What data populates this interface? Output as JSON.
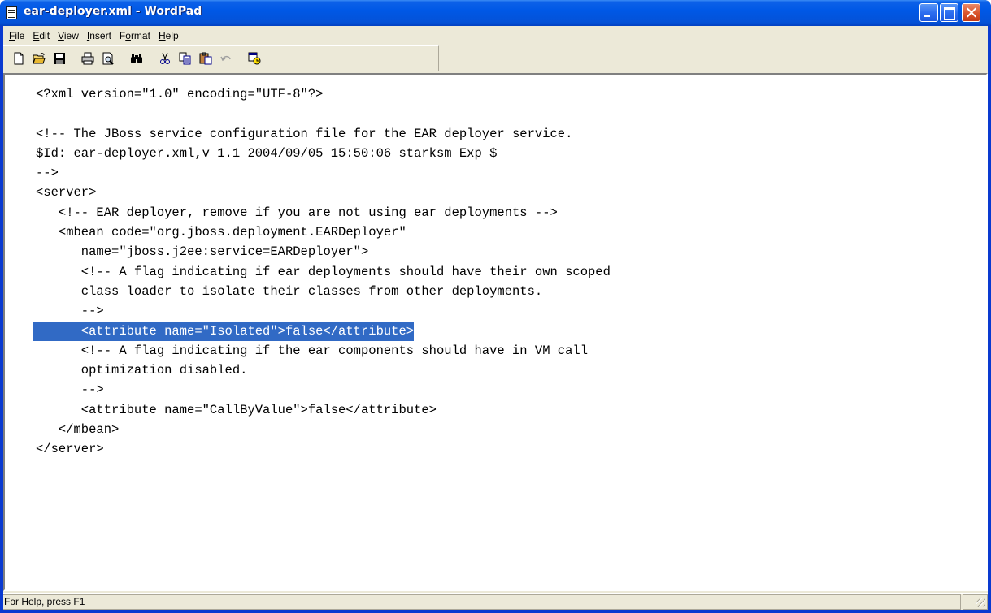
{
  "window": {
    "title": "ear-deployer.xml - WordPad",
    "icon": "wordpad-document-icon"
  },
  "menubar": [
    {
      "pre": "",
      "u": "F",
      "post": "ile"
    },
    {
      "pre": "",
      "u": "E",
      "post": "dit"
    },
    {
      "pre": "",
      "u": "V",
      "post": "iew"
    },
    {
      "pre": "",
      "u": "I",
      "post": "nsert"
    },
    {
      "pre": "F",
      "u": "o",
      "post": "rmat"
    },
    {
      "pre": "",
      "u": "H",
      "post": "elp"
    }
  ],
  "toolbar": [
    "new-icon",
    "open-icon",
    "save-icon",
    "print-icon",
    "print-preview-icon",
    "find-icon",
    "cut-icon",
    "copy-icon",
    "paste-icon",
    "undo-icon",
    "date-time-icon"
  ],
  "document": {
    "lines": [
      "<?xml version=\"1.0\" encoding=\"UTF-8\"?>",
      "",
      "<!-- The JBoss service configuration file for the EAR deployer service.",
      "$Id: ear-deployer.xml,v 1.1 2004/09/05 15:50:06 starksm Exp $",
      "-->",
      "<server>",
      "   <!-- EAR deployer, remove if you are not using ear deployments -->",
      "   <mbean code=\"org.jboss.deployment.EARDeployer\"",
      "      name=\"jboss.j2ee:service=EARDeployer\">",
      "      <!-- A flag indicating if ear deployments should have their own scoped",
      "      class loader to isolate their classes from other deployments.",
      "      -->",
      "      <attribute name=\"Isolated\">false</attribute>",
      "      <!-- A flag indicating if the ear components should have in VM call",
      "      optimization disabled.",
      "      -->",
      "      <attribute name=\"CallByValue\">false</attribute>",
      "   </mbean>",
      "</server>"
    ],
    "selected_line_index": 12
  },
  "statusbar": {
    "text": "For Help, press F1"
  },
  "colors": {
    "titlebar": "#0058e6",
    "selection": "#316ac5",
    "chrome": "#ece9d8"
  }
}
